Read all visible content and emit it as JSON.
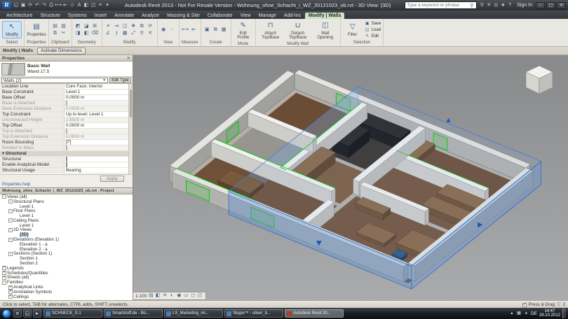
{
  "titlebar": {
    "logo_letter": "R",
    "qat_icons": [
      "open-icon",
      "save-icon",
      "sync-icon",
      "undo-icon",
      "redo-icon",
      "print-icon",
      "measure-icon",
      "aligned-dimension-icon",
      "tag-icon",
      "text-icon",
      "default-3d-view-icon",
      "section-icon",
      "thin-lines-icon",
      "switch-windows-icon"
    ],
    "title": "Autodesk Revit 2013 - Not For Resale Version - Wohnung_ohne_Schacht_i_WZ_20121023_ob.rvt - 3D View: {3D}",
    "search_placeholder": "Type a keyword or phrase",
    "signin_label": "Sign In",
    "help_icons": [
      "search-icon",
      "exchange-apps-icon",
      "communication-center-icon",
      "favorites-icon",
      "help-icon"
    ]
  },
  "ribbon": {
    "tabs": [
      "Architecture",
      "Structure",
      "Systems",
      "Insert",
      "Annotate",
      "Analyze",
      "Massing & Site",
      "Collaborate",
      "View",
      "Manage",
      "Add-Ins",
      "Modify | Walls"
    ],
    "active_tab": "Modify | Walls",
    "select_panel": {
      "label": "Select",
      "button": "Modify"
    },
    "properties_panel": {
      "label": "Properties",
      "button": "Properties"
    },
    "clipboard_panel": {
      "label": "Clipboard",
      "icons": [
        "paste-icon",
        "match-type-icon",
        "copy-icon",
        "cut-icon"
      ]
    },
    "geometry_panel": {
      "label": "Geometry",
      "icons": [
        "cope-icon",
        "cut-geometry-icon",
        "join-icon",
        "paint-icon",
        "split-face-icon",
        "demolish-icon"
      ]
    },
    "modify_panel": {
      "label": "Modify",
      "icons": [
        "align-icon",
        "offset-icon",
        "mirror-axis-icon",
        "move-icon",
        "copy-move-icon",
        "rotate-icon",
        "trim-extend-icon",
        "split-element-icon",
        "array-icon",
        "scale-icon",
        "pin-icon",
        "delete-icon"
      ]
    },
    "view_panel": {
      "label": "View",
      "icons": [
        "visibility-icon",
        "hide-elements-icon"
      ]
    },
    "measure_panel": {
      "label": "Measure",
      "icons": [
        "measure-between-icon",
        "dimension-icon"
      ]
    },
    "create_panel": {
      "label": "Create",
      "icons": [
        "create-group-icon",
        "create-similar-icon",
        "create-assembly-icon"
      ]
    },
    "mode_panel": {
      "label": "Mode",
      "edit_profile": "Edit Profile"
    },
    "modify_wall_panel": {
      "label": "Modify Wall",
      "attach": "Attach Top/Base",
      "detach": "Detach Top/Base",
      "opening": "Wall Opening"
    },
    "selection_panel": {
      "label": "Selection",
      "filter": "Filter",
      "save": "Save",
      "load": "Load",
      "edit": "Edit"
    }
  },
  "options_bar": {
    "context": "Modify | Walls",
    "activate_dimensions": "Activate Dimensions"
  },
  "properties_palette": {
    "header": "Properties",
    "close": "✕",
    "type_family": "Basic Wall",
    "type_name": "Wand 17.5",
    "selector": "Walls (2)",
    "edit_type": "Edit Type",
    "rows": [
      {
        "label": "Location Line",
        "value": "Core Face: Interior",
        "type": "text"
      },
      {
        "label": "Base Constraint",
        "value": "Level 1",
        "type": "text"
      },
      {
        "label": "Base Offset",
        "value": "0.0000 m",
        "type": "text"
      },
      {
        "label": "Base is Attached",
        "type": "check",
        "checked": false,
        "disabled": true
      },
      {
        "label": "Base Extension Distance",
        "value": "0.0000 m",
        "type": "text",
        "disabled": true
      },
      {
        "label": "Top Constraint",
        "value": "Up to level: Level 1",
        "type": "text"
      },
      {
        "label": "Unconnected Height",
        "value": "2.6500 m",
        "type": "text",
        "disabled": true
      },
      {
        "label": "Top Offset",
        "value": "0.0000 m",
        "type": "text"
      },
      {
        "label": "Top is Attached",
        "type": "check",
        "checked": false,
        "disabled": true
      },
      {
        "label": "Top Extension Distance",
        "value": "0.0000 m",
        "type": "text",
        "disabled": true
      },
      {
        "label": "Room Bounding",
        "type": "check",
        "checked": true
      },
      {
        "label": "Related to Mass",
        "type": "check",
        "checked": false,
        "disabled": true
      },
      {
        "label": "Structural",
        "type": "section"
      },
      {
        "label": "Structural",
        "type": "check",
        "checked": false
      },
      {
        "label": "Enable Analytical Model",
        "type": "check",
        "checked": false
      },
      {
        "label": "Structural Usage",
        "value": "Bearing",
        "type": "text"
      }
    ],
    "apply_label": "Apply",
    "help_link": "Properties help"
  },
  "project_browser": {
    "header": "Wohnung_ohne_Schacht_i_WZ_20121023_ob.rvt - Project Browser",
    "nodes": [
      {
        "label": "Views (all)",
        "indent": 0,
        "exp": "-"
      },
      {
        "label": "Structural Plans",
        "indent": 1,
        "exp": "-"
      },
      {
        "label": "Level 1",
        "indent": 2,
        "exp": ""
      },
      {
        "label": "Floor Plans",
        "indent": 1,
        "exp": "-"
      },
      {
        "label": "Level 1",
        "indent": 2,
        "exp": ""
      },
      {
        "label": "Ceiling Plans",
        "indent": 1,
        "exp": "-"
      },
      {
        "label": "Level 1",
        "indent": 2,
        "exp": ""
      },
      {
        "label": "3D Views",
        "indent": 1,
        "exp": "-"
      },
      {
        "label": "{3D}",
        "indent": 2,
        "exp": "",
        "selected": true
      },
      {
        "label": "Elevations (Elevation 1)",
        "indent": 1,
        "exp": "-"
      },
      {
        "label": "Elevation 1 - a",
        "indent": 2,
        "exp": ""
      },
      {
        "label": "Elevation 2 - a",
        "indent": 2,
        "exp": ""
      },
      {
        "label": "Sections (Section 1)",
        "indent": 1,
        "exp": "-"
      },
      {
        "label": "Section 1",
        "indent": 2,
        "exp": ""
      },
      {
        "label": "Section 2",
        "indent": 2,
        "exp": ""
      },
      {
        "label": "Legends",
        "indent": 0,
        "exp": "+"
      },
      {
        "label": "Schedules/Quantities",
        "indent": 0,
        "exp": "+"
      },
      {
        "label": "Sheets (all)",
        "indent": 0,
        "exp": "+"
      },
      {
        "label": "Families",
        "indent": 0,
        "exp": "-"
      },
      {
        "label": "Analytical Links",
        "indent": 1,
        "exp": "+"
      },
      {
        "label": "Annotation Symbols",
        "indent": 1,
        "exp": "+"
      },
      {
        "label": "Ceilings",
        "indent": 1,
        "exp": "+"
      }
    ]
  },
  "view_controls": {
    "scale": "1:100",
    "icons": [
      "detail-level-icon",
      "visual-style-icon",
      "sun-path-icon",
      "shadows-icon",
      "rendering-icon",
      "crop-view-icon",
      "show-crop-icon",
      "unlocked-view-icon"
    ]
  },
  "status_bar": {
    "hint": "Click to select, TAB for alternates, CTRL adds, SHIFT unselects.",
    "press_drag": "Press & Drag",
    "filter_count": "2"
  },
  "taskbar": {
    "quicklaunch": [
      "ie-icon",
      "explorer-icon",
      "media-player-icon"
    ],
    "windows": [
      {
        "label": "SCHNECK_S.1",
        "active": false
      },
      {
        "label": "Smartstoff.de - Bü...",
        "active": false
      },
      {
        "label": "LS_Marketing_mi...",
        "active": false
      },
      {
        "label": "Skype™ - oliver_b...",
        "active": false
      },
      {
        "label": "Autodesk Revit 20...",
        "active": true
      }
    ],
    "tray_icons": [
      "hidden-icons-icon",
      "network-icon",
      "volume-icon"
    ],
    "tray_lang": "DE",
    "time": "14:47",
    "date": "29.10.2012"
  },
  "colors": {
    "selection_blue": "#2f6fc8",
    "highlight_green": "#00cf00",
    "contextual_tab": "#cfe0c8"
  }
}
